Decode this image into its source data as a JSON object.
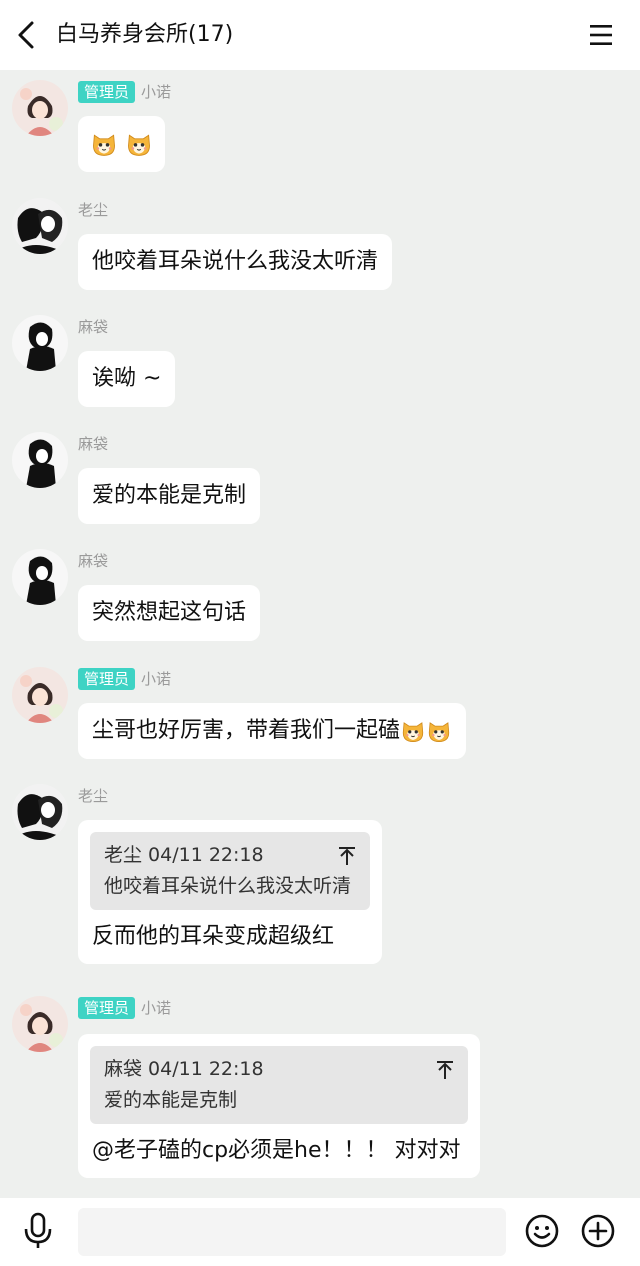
{
  "header": {
    "title": "白马养身会所(17)"
  },
  "badges": {
    "admin": "管理员"
  },
  "messages": [
    {
      "sender": "小诺",
      "admin": true,
      "text": "",
      "emoji_count": 2
    },
    {
      "sender": "老尘",
      "admin": false,
      "text": "他咬着耳朵说什么我没太听清"
    },
    {
      "sender": "麻袋",
      "admin": false,
      "text": "诶呦 ~"
    },
    {
      "sender": "麻袋",
      "admin": false,
      "text": "爱的本能是克制"
    },
    {
      "sender": "麻袋",
      "admin": false,
      "text": "突然想起这句话"
    },
    {
      "sender": "小诺",
      "admin": true,
      "text": "尘哥也好厉害，带着我们一起磕",
      "emoji_count": 2
    },
    {
      "sender": "老尘",
      "admin": false,
      "quote": {
        "head": "老尘 04/11 22:18",
        "text": "他咬着耳朵说什么我没太听清"
      },
      "text": "反而他的耳朵变成超级红"
    },
    {
      "sender": "小诺",
      "admin": true,
      "quote": {
        "head": "麻袋 04/11 22:18",
        "text": "爱的本能是克制"
      },
      "text": "@老子磕的cp必须是he！！！ 对对对"
    }
  ],
  "input": {
    "placeholder": ""
  },
  "icons": {
    "back": "back-arrow-icon",
    "menu": "menu-icon",
    "quote_top": "pin-top-icon",
    "mic": "microphone-icon",
    "emoji": "smiley-icon",
    "plus": "plus-circle-icon"
  },
  "colors": {
    "admin_badge": "#3ed3c4",
    "background": "#eef0ee",
    "bubble": "#ffffff"
  }
}
